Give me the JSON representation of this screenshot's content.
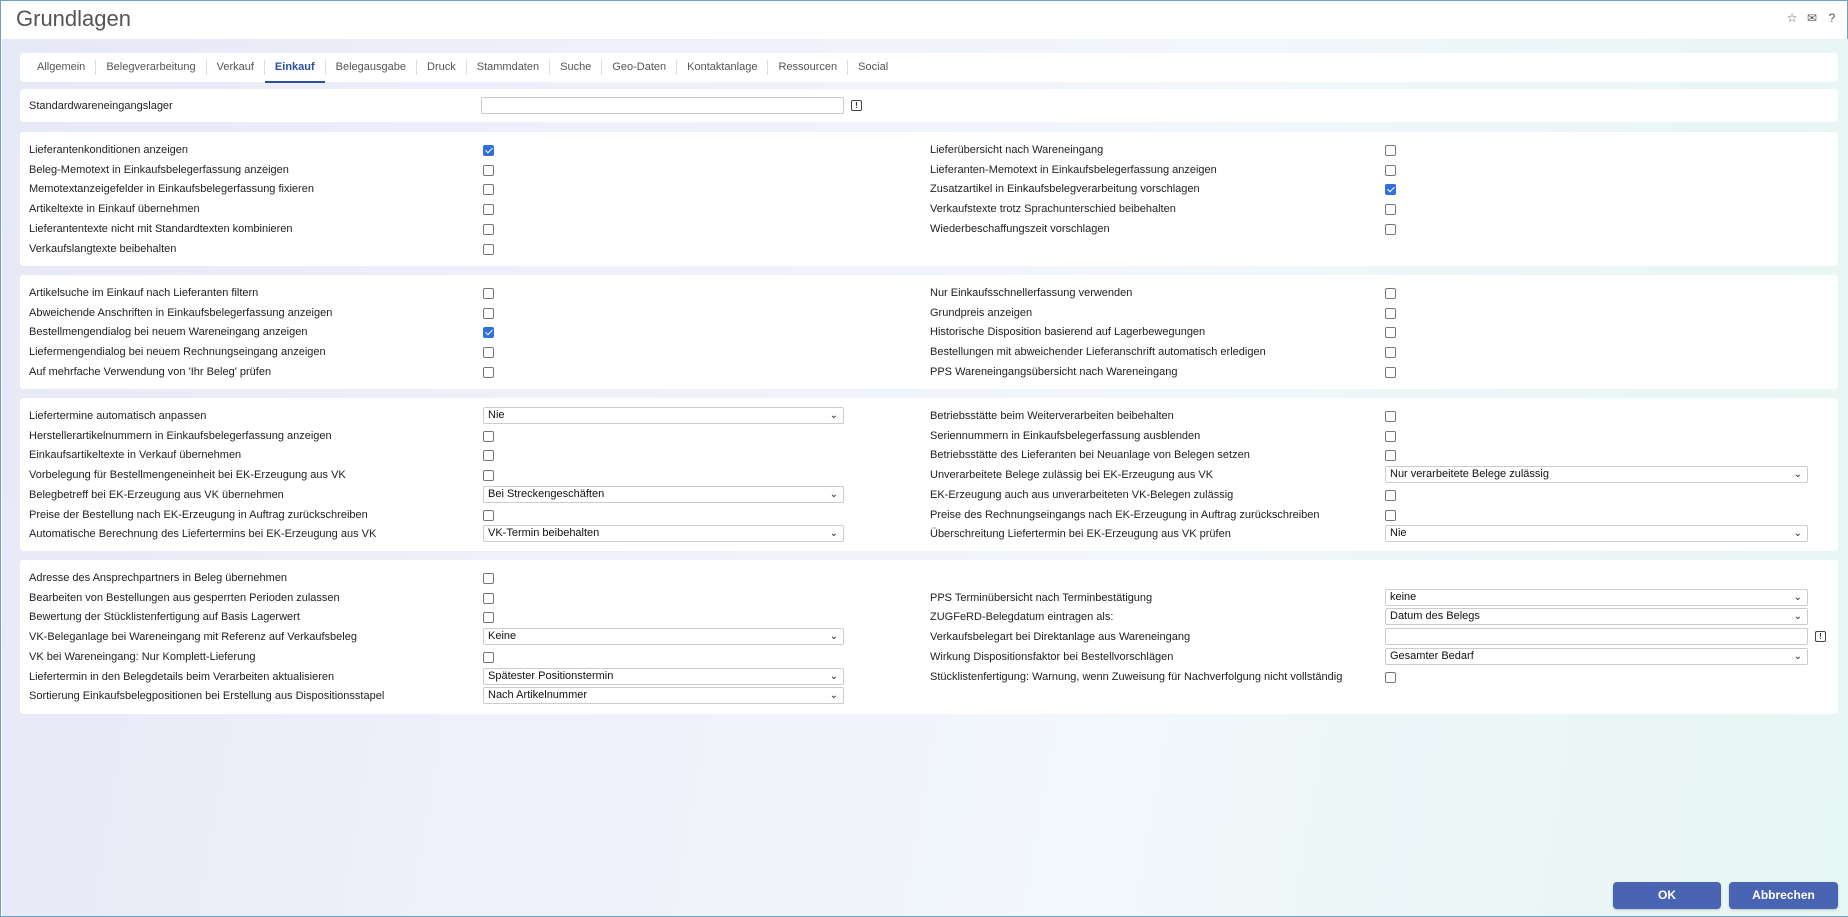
{
  "window": {
    "title": "Grundlagen"
  },
  "titlebar_icons": [
    "star-icon",
    "mail-icon",
    "help-icon"
  ],
  "tabs": [
    {
      "label": "Allgemein"
    },
    {
      "label": "Belegverarbeitung"
    },
    {
      "label": "Verkauf"
    },
    {
      "label": "Einkauf",
      "active": true
    },
    {
      "label": "Belegausgabe"
    },
    {
      "label": "Druck"
    },
    {
      "label": "Stammdaten"
    },
    {
      "label": "Suche"
    },
    {
      "label": "Geo-Daten"
    },
    {
      "label": "Kontaktanlage"
    },
    {
      "label": "Ressourcen"
    },
    {
      "label": "Social"
    }
  ],
  "section1": {
    "label": "Standardwareneingangslager",
    "value": ""
  },
  "section2": {
    "left": [
      {
        "label": "Lieferantenkonditionen anzeigen",
        "checked": true
      },
      {
        "label": "Beleg-Memotext in Einkaufsbelegerfassung anzeigen",
        "checked": false
      },
      {
        "label": "Memotextanzeigefelder in Einkaufsbelegerfassung fixieren",
        "checked": false
      },
      {
        "label": "Artikeltexte in Einkauf übernehmen",
        "checked": false
      },
      {
        "label": "Lieferantentexte nicht mit Standardtexten kombinieren",
        "checked": false
      },
      {
        "label": "Verkaufslangtexte beibehalten",
        "checked": false
      }
    ],
    "right": [
      {
        "label": "Lieferübersicht nach Wareneingang",
        "checked": false
      },
      {
        "label": "Lieferanten-Memotext in Einkaufsbelegerfassung anzeigen",
        "checked": false
      },
      {
        "label": "Zusatzartikel in Einkaufsbelegverarbeitung vorschlagen",
        "checked": true
      },
      {
        "label": "Verkaufstexte trotz Sprachunterschied beibehalten",
        "checked": false
      },
      {
        "label": "Wiederbeschaffungszeit vorschlagen",
        "checked": false
      }
    ]
  },
  "section3": {
    "left": [
      {
        "label": "Artikelsuche im Einkauf nach Lieferanten filtern",
        "checked": false
      },
      {
        "label": "Abweichende Anschriften in Einkaufsbelegerfassung anzeigen",
        "checked": false
      },
      {
        "label": "Bestellmengendialog bei neuem Wareneingang anzeigen",
        "checked": true
      },
      {
        "label": "Liefermengendialog bei neuem Rechnungseingang anzeigen",
        "checked": false
      },
      {
        "label": "Auf mehrfache Verwendung von 'Ihr Beleg' prüfen",
        "checked": false
      }
    ],
    "right": [
      {
        "label": "Nur Einkaufsschnellerfassung verwenden",
        "checked": false
      },
      {
        "label": "Grundpreis anzeigen",
        "checked": false
      },
      {
        "label": "Historische Disposition basierend auf Lagerbewegungen",
        "checked": false
      },
      {
        "label": "Bestellungen mit abweichender Lieferanschrift automatisch erledigen",
        "checked": false
      },
      {
        "label": "PPS Wareneingangsübersicht nach Wareneingang",
        "checked": false
      }
    ]
  },
  "section4": {
    "left": [
      {
        "label": "Liefertermine automatisch anpassen",
        "select": "Nie"
      },
      {
        "label": "Herstellerartikelnummern in Einkaufsbelegerfassung anzeigen",
        "checked": false
      },
      {
        "label": "Einkaufsartikeltexte in Verkauf übernehmen",
        "checked": false
      },
      {
        "label": "Vorbelegung für Bestellmengeneinheit bei EK-Erzeugung aus VK",
        "checked": false
      },
      {
        "label": "Belegbetreff bei EK-Erzeugung aus VK übernehmen",
        "select": "Bei Streckengeschäften"
      },
      {
        "label": "Preise der Bestellung nach EK-Erzeugung in Auftrag zurückschreiben",
        "checked": false
      },
      {
        "label": "Automatische Berechnung des Liefertermins bei EK-Erzeugung aus VK",
        "select": "VK-Termin beibehalten"
      }
    ],
    "right": [
      {
        "label": "Betriebsstätte beim Weiterverarbeiten beibehalten",
        "checked": false
      },
      {
        "label": "Seriennummern in Einkaufsbelegerfassung ausblenden",
        "checked": false
      },
      {
        "label": "Betriebsstätte des Lieferanten bei Neuanlage von Belegen setzen",
        "checked": false
      },
      {
        "label": "Unverarbeitete Belege zulässig bei EK-Erzeugung aus VK",
        "select": "Nur verarbeitete Belege zulässig"
      },
      {
        "label": "EK-Erzeugung auch aus unverarbeiteten VK-Belegen zulässig",
        "checked": false
      },
      {
        "label": "Preise des Rechnungseingangs nach EK-Erzeugung in Auftrag zurückschreiben",
        "checked": false
      },
      {
        "label": "Überschreitung Liefertermin bei EK-Erzeugung aus VK prüfen",
        "select": "Nie"
      }
    ]
  },
  "section5": {
    "left": [
      {
        "label": "Adresse des Ansprechpartners in Beleg übernehmen",
        "checked": false
      },
      {
        "label": "Bearbeiten von Bestellungen aus gesperrten Perioden zulassen",
        "checked": false
      },
      {
        "label": "Bewertung der Stücklistenfertigung auf Basis Lagerwert",
        "checked": false
      },
      {
        "label": "VK-Beleganlage bei Wareneingang mit Referenz auf Verkaufsbeleg",
        "select": "Keine"
      },
      {
        "label": "VK bei Wareneingang: Nur Komplett-Lieferung",
        "checked": false
      },
      {
        "label": "Liefertermin in den Belegdetails beim Verarbeiten aktualisieren",
        "select": "Spätester Positionstermin"
      },
      {
        "label": "Sortierung Einkaufsbelegpositionen bei Erstellung aus Dispositionsstapel",
        "select": "Nach Artikelnummer"
      }
    ],
    "right": [
      null,
      {
        "label": "PPS Terminübersicht nach Terminbestätigung",
        "select": "keine"
      },
      {
        "label": "ZUGFeRD-Belegdatum eintragen als:",
        "select": "Datum des Belegs"
      },
      {
        "label": "Verkaufsbelegart bei Direktanlage aus Wareneingang",
        "input": ""
      },
      {
        "label": "Wirkung Dispositionsfaktor bei Bestellvorschlägen",
        "select": "Gesamter Bedarf"
      },
      {
        "label": "Stücklistenfertigung: Warnung, wenn Zuweisung für Nachverfolgung nicht vollständig",
        "checked": false
      }
    ]
  },
  "buttons": {
    "ok": "OK",
    "cancel": "Abbrechen"
  },
  "colors": {
    "accent": "#2a4fa0",
    "button": "#4a64b4",
    "checkbox_on": "#2f6fde"
  }
}
